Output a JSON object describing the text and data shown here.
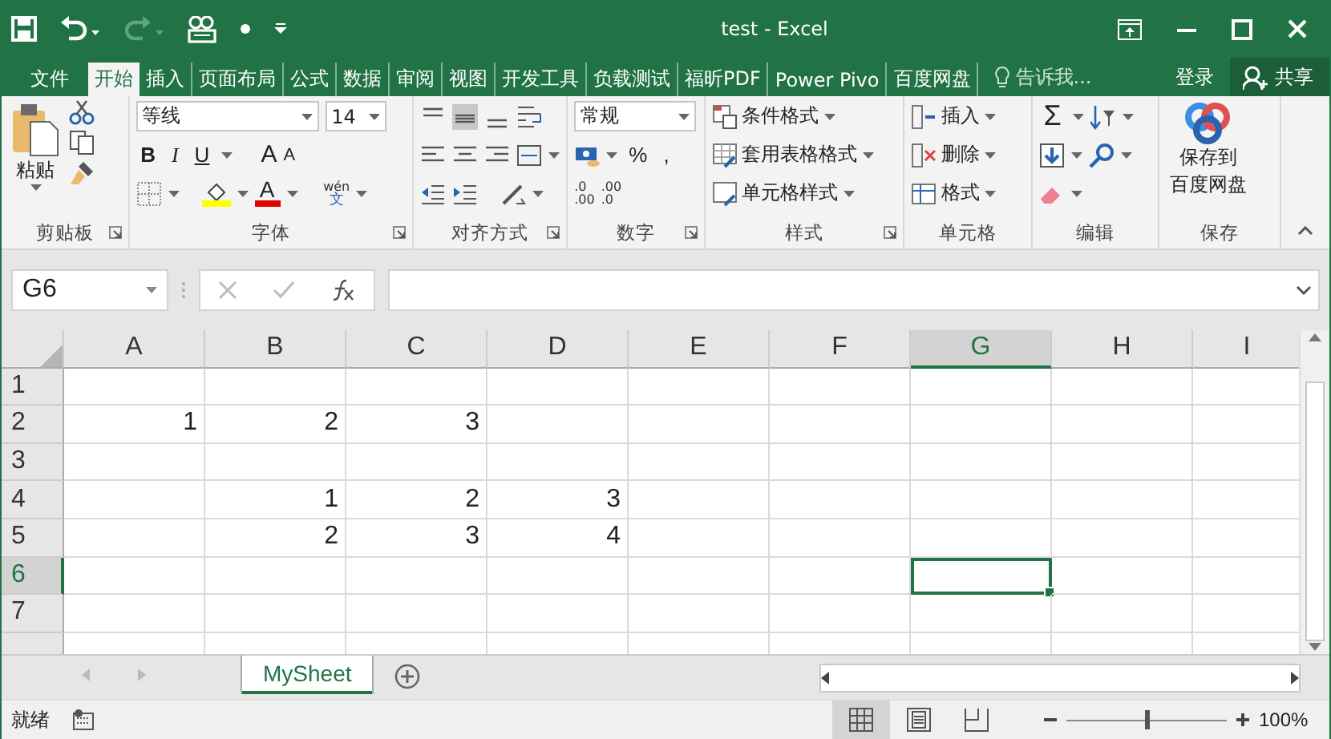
{
  "window": {
    "title": "test - Excel"
  },
  "menu_tabs": [
    {
      "label": "文件",
      "selected": false
    },
    {
      "label": "开始",
      "selected": true
    },
    {
      "label": "插入",
      "selected": false
    },
    {
      "label": "页面布局",
      "selected": false
    },
    {
      "label": "公式",
      "selected": false
    },
    {
      "label": "数据",
      "selected": false
    },
    {
      "label": "审阅",
      "selected": false
    },
    {
      "label": "视图",
      "selected": false
    },
    {
      "label": "开发工具",
      "selected": false
    },
    {
      "label": "负载测试",
      "selected": false
    },
    {
      "label": "福昕PDF",
      "selected": false
    },
    {
      "label": "Power Pivo",
      "selected": false
    },
    {
      "label": "百度网盘",
      "selected": false
    }
  ],
  "tell_me": {
    "placeholder": "告诉我..."
  },
  "login": "登录",
  "share": "共享",
  "ribbon": [
    {
      "kind": "clipboard",
      "label": "剪贴板",
      "paste": "粘贴"
    },
    {
      "kind": "font",
      "label": "字体",
      "font_name": "等线",
      "font_size": "14",
      "style_buttons": [
        "B",
        "I",
        "U"
      ],
      "size_buttons": [
        "A",
        "A"
      ],
      "color_letter": "A",
      "phonetic": [
        "wén",
        "文"
      ]
    },
    {
      "kind": "alignment",
      "label": "对齐方式"
    },
    {
      "kind": "number",
      "label": "数字",
      "format": "常规",
      "symbols": [
        "%",
        ","
      ],
      "decimals": [
        {
          "top": ".0",
          "bottom": ".00"
        },
        {
          "top": ".00",
          "bottom": ".0"
        }
      ]
    },
    {
      "kind": "styles",
      "label": "样式",
      "items": [
        "条件格式",
        "套用表格格式",
        "单元格样式"
      ]
    },
    {
      "kind": "cells",
      "label": "单元格",
      "items": [
        "插入",
        "删除",
        "格式"
      ]
    },
    {
      "kind": "editing",
      "label": "编辑",
      "sum": "Σ"
    },
    {
      "kind": "save",
      "label": "保存",
      "lines": [
        "保存到",
        "百度网盘"
      ]
    }
  ],
  "name_box": "G6",
  "grid": {
    "columns": [
      {
        "label": "A",
        "selected": false
      },
      {
        "label": "B",
        "selected": false
      },
      {
        "label": "C",
        "selected": false
      },
      {
        "label": "D",
        "selected": false
      },
      {
        "label": "E",
        "selected": false
      },
      {
        "label": "F",
        "selected": false
      },
      {
        "label": "G",
        "selected": true
      },
      {
        "label": "H",
        "selected": false
      },
      {
        "label": "I",
        "selected": false
      }
    ],
    "rows": [
      {
        "label": "1",
        "selected": false,
        "cells": [
          "",
          "",
          "",
          "",
          "",
          "",
          "",
          "",
          ""
        ]
      },
      {
        "label": "2",
        "selected": false,
        "cells": [
          "1",
          "2",
          "3",
          "",
          "",
          "",
          "",
          "",
          ""
        ]
      },
      {
        "label": "3",
        "selected": false,
        "cells": [
          "",
          "",
          "",
          "",
          "",
          "",
          "",
          "",
          ""
        ]
      },
      {
        "label": "4",
        "selected": false,
        "cells": [
          "",
          "1",
          "2",
          "3",
          "",
          "",
          "",
          "",
          ""
        ]
      },
      {
        "label": "5",
        "selected": false,
        "cells": [
          "",
          "2",
          "3",
          "4",
          "",
          "",
          "",
          "",
          ""
        ]
      },
      {
        "label": "6",
        "selected": true,
        "cells": [
          "",
          "",
          "",
          "",
          "",
          "",
          "",
          "",
          ""
        ]
      },
      {
        "label": "7",
        "selected": false,
        "cells": [
          "",
          "",
          "",
          "",
          "",
          "",
          "",
          "",
          ""
        ]
      }
    ]
  },
  "sheet_tabs": [
    {
      "label": "MySheet",
      "selected": true
    }
  ],
  "status_bar": {
    "status": "就绪",
    "views": [
      {
        "kind": "normal",
        "selected": true
      },
      {
        "kind": "page_layout",
        "selected": false
      },
      {
        "kind": "page_break",
        "selected": false
      }
    ],
    "zoom": {
      "level": 0.5,
      "reading": "100%"
    }
  }
}
